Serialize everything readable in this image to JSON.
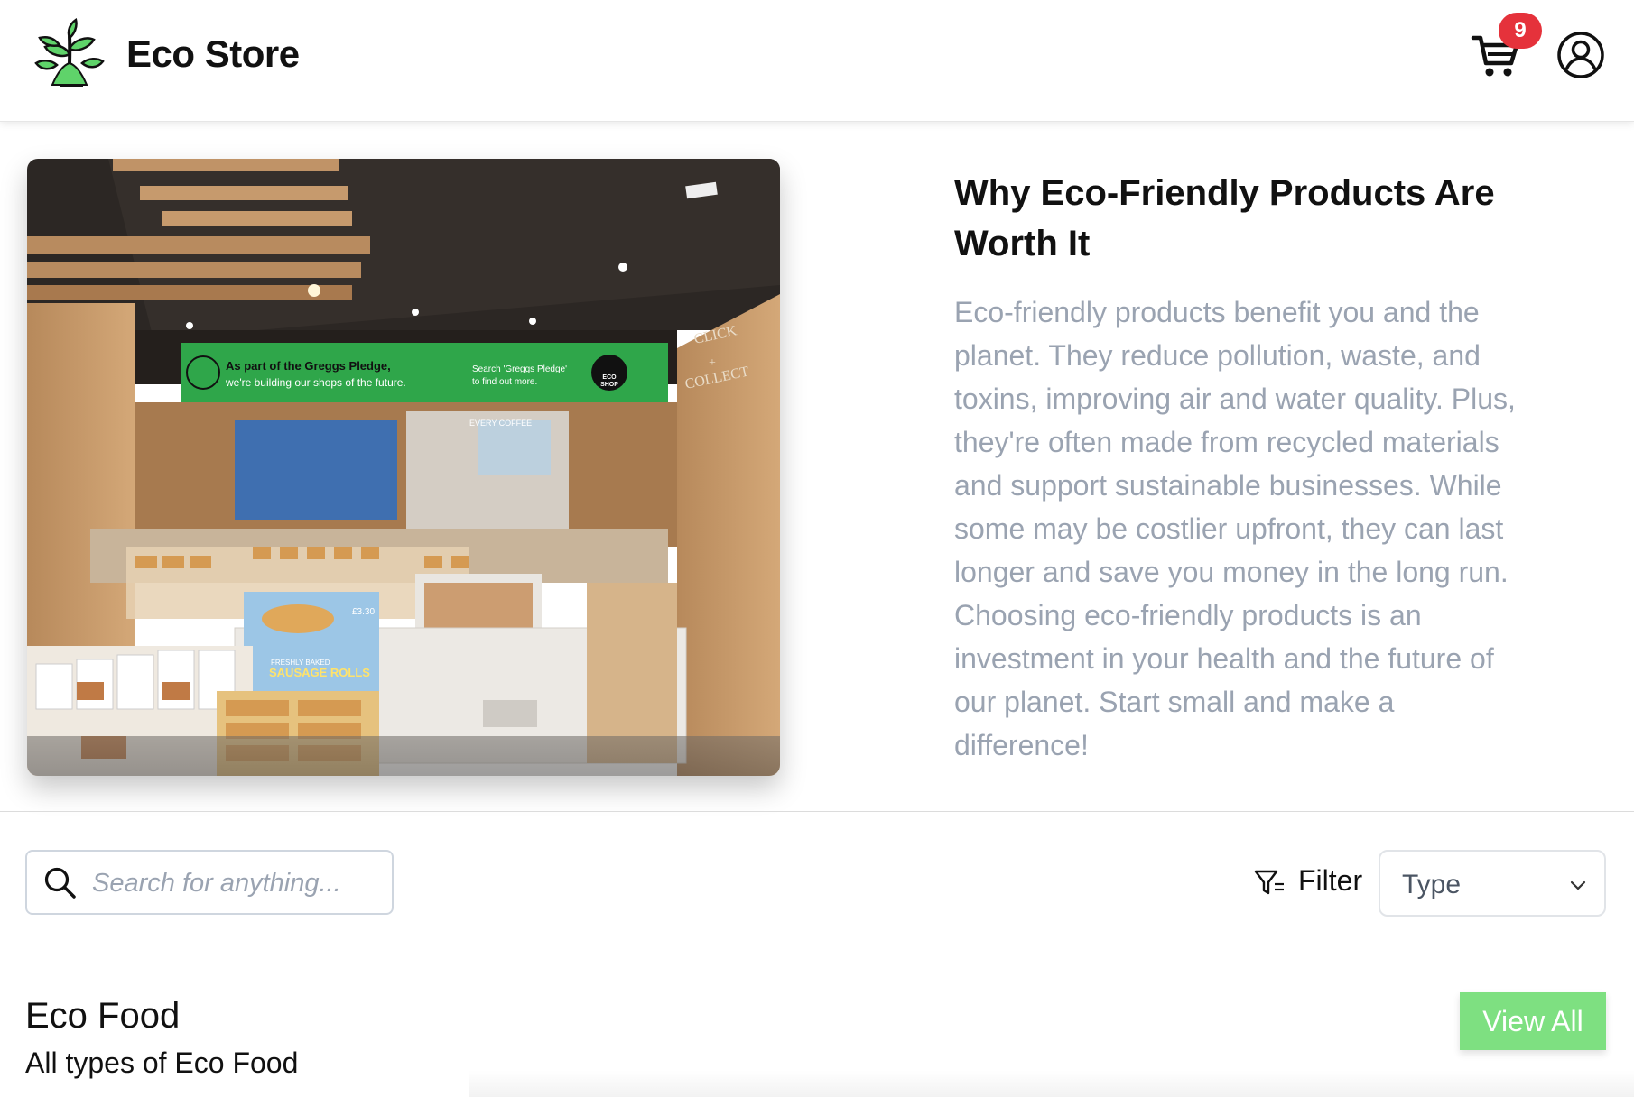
{
  "header": {
    "brand": "Eco Store",
    "cart_count": "9"
  },
  "hero": {
    "image": {
      "banner_line1": "As part of the Greggs Pledge,",
      "banner_line2": "we're building our shops of the future.",
      "banner_search_line1": "Search 'Greggs Pledge'",
      "banner_search_line2": "to find out more.",
      "badge_line1": "ECO",
      "badge_line2": "SHOP",
      "side_sign_line1": "CLICK",
      "side_sign_line2": "+",
      "side_sign_line3": "COLLECT",
      "counter_label_line1": "FRESHLY BAKED",
      "counter_label_line2": "SAUSAGE ROLLS",
      "price_tag": "£3.30",
      "coffee_sign": "EVERY COFFEE"
    },
    "title": "Why Eco-Friendly Products Are Worth It",
    "body": "Eco-friendly products benefit you and the planet. They reduce pollution, waste, and toxins, improving air and water quality. Plus, they're often made from recycled materials and support sustainable businesses. While some may be costlier upfront, they can last longer and save you money in the long run. Choosing eco-friendly products is an investment in your health and the future of our planet. Start small and make a difference!"
  },
  "toolbar": {
    "search_placeholder": "Search for anything...",
    "filter_label": "Filter",
    "type_select_value": "Type"
  },
  "section": {
    "title": "Eco Food",
    "subtitle": "All types of Eco Food",
    "view_all_label": "View All"
  },
  "colors": {
    "accent_green": "#7ee081",
    "badge_red": "#e5323b",
    "muted_text": "#9aa3b1"
  },
  "icons": [
    "plant-logo-icon",
    "cart-icon",
    "user-icon",
    "search-icon",
    "filter-icon",
    "chevron-down-icon"
  ]
}
